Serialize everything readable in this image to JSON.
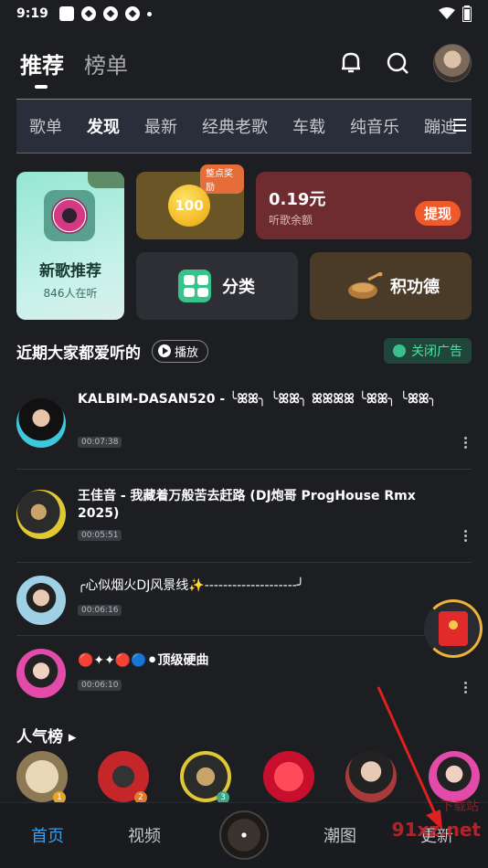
{
  "status": {
    "time": "9:19"
  },
  "top_tabs": [
    "推荐",
    "榜单"
  ],
  "categories": [
    "歌单",
    "发现",
    "最新",
    "经典老歌",
    "车载",
    "纯音乐",
    "蹦迪"
  ],
  "cards": {
    "new_songs": {
      "title": "新歌推荐",
      "listeners": "846人在听"
    },
    "coin": {
      "badge": "整点奖励",
      "value": "100"
    },
    "balance": {
      "amount": "0.19元",
      "label": "听歌余额",
      "button": "提现"
    },
    "category": {
      "label": "分类"
    },
    "merit": {
      "label": "积功德"
    }
  },
  "section": {
    "title": "近期大家都爱听的",
    "play": "播放",
    "close_ad": "关闭广告"
  },
  "songs": [
    {
      "title": "KALBIM-DASAN520 - ╰ꕤꕤ╮ ╰ꕤꕤ╮ ꕤꕤꕤꕤ ╰ꕤꕤ╮ ╰ꕤꕤ╮",
      "duration": "00:07:38"
    },
    {
      "title": "王佳音 - 我藏着万般苦去赶路 (DJ炮哥 ProgHouse Rmx 2025)",
      "duration": "00:05:51"
    },
    {
      "title": "╭心似烟火DJ风景线✨--------------------╯",
      "duration": "00:06:16"
    },
    {
      "title": "🔴✦✦🔴🔵⚫顶级硬曲",
      "duration": "00:06:10"
    }
  ],
  "popular": {
    "title": "人气榜 ▸",
    "ranks": [
      "1",
      "2",
      "3"
    ]
  },
  "bottom_nav": [
    "首页",
    "视频",
    "潮图",
    "更新"
  ],
  "watermark": {
    "main": "91xz.net",
    "sub": "下载站"
  },
  "colors": {
    "accent": "#3a9dea",
    "background": "#1d1e22"
  }
}
